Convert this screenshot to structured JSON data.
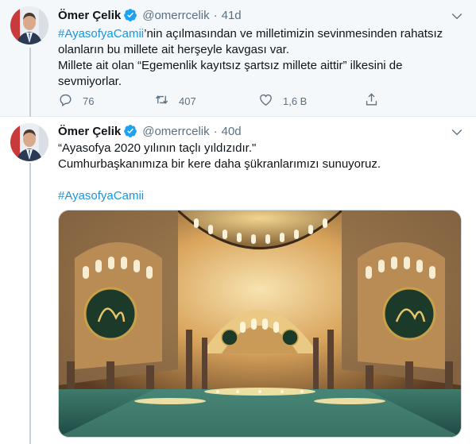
{
  "tweets": [
    {
      "author_name": "Ömer Çelik",
      "handle": "@omerrcelik",
      "separator": "·",
      "time": "41d",
      "text_lines": [
        {
          "hashtag": "#AyasofyaCamii",
          "rest": "’nin açılmasından ve milletimizin sevinmesinden rahatsız"
        },
        {
          "hashtag": "",
          "rest": "olanların bu millete ait herşeyle kavgası var."
        },
        {
          "hashtag": "",
          "rest": "Millete ait olan “Egemenlik kayıtsız şartsız millete aittir” ilkesini de"
        },
        {
          "hashtag": "",
          "rest": "sevmiyorlar."
        }
      ],
      "reply_count": "76",
      "retweet_count": "407",
      "like_count": "1,6 B"
    },
    {
      "author_name": "Ömer Çelik",
      "handle": "@omerrcelik",
      "separator": "·",
      "time": "40d",
      "line1": "“Ayasofya 2020 yılının taçlı yıldızıdır.\"",
      "line2": "Cumhurbaşkanımıza bir kere daha şükranlarımızı sunuyoruz.",
      "hashtag": "#AyasofyaCamii",
      "image_name": "hagia-sophia-interior"
    }
  ],
  "colors": {
    "link": "#1b95e0",
    "verified": "#1da1f2",
    "muted": "#5b7083",
    "thread_line": "#c4cfd6",
    "highlight_bg": "#f5f8fa"
  },
  "icons": {
    "verified": "verified-badge-icon",
    "more": "more-options-icon",
    "reply": "reply-icon",
    "retweet": "retweet-icon",
    "like": "heart-icon",
    "share": "share-icon"
  }
}
